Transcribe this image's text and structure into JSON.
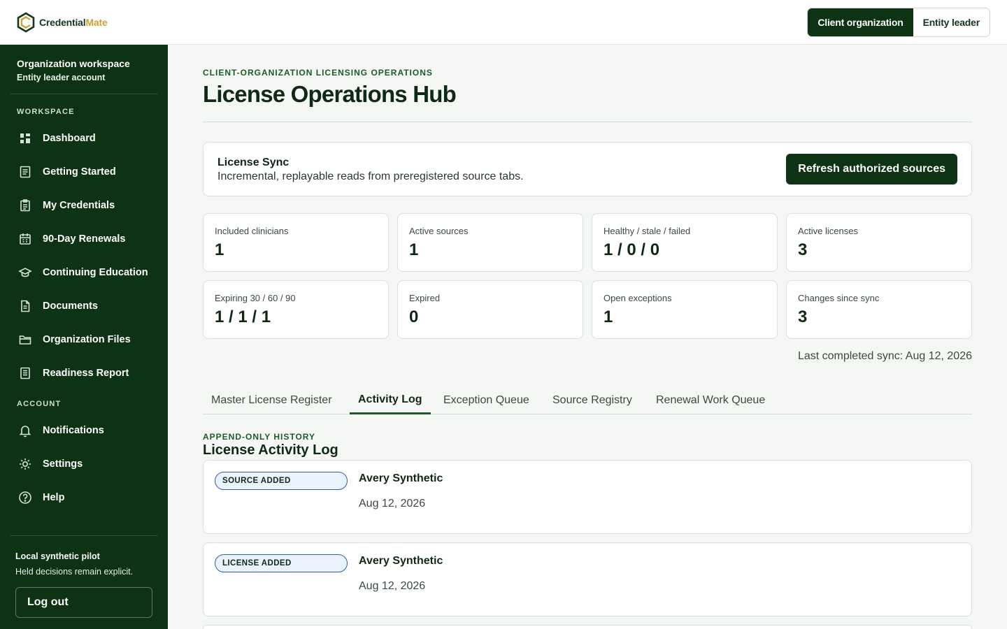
{
  "brand": {
    "name_primary": "Credential",
    "name_accent": "Mate"
  },
  "role_switch": {
    "options": [
      "Client organization",
      "Entity leader"
    ],
    "selected": "Client organization"
  },
  "sidebar": {
    "workspace_title": "Organization workspace",
    "workspace_subtitle": "Entity leader account",
    "workspace_section": "WORKSPACE",
    "workspace_items": [
      {
        "label": "Dashboard",
        "icon": "dashboard-icon"
      },
      {
        "label": "Getting Started",
        "icon": "checklist-icon"
      },
      {
        "label": "My Credentials",
        "icon": "clipboard-icon"
      },
      {
        "label": "90-Day Renewals",
        "icon": "calendar-icon"
      },
      {
        "label": "Continuing Education",
        "icon": "graduation-cap-icon"
      },
      {
        "label": "Documents",
        "icon": "document-icon"
      },
      {
        "label": "Organization Files",
        "icon": "folder-icon"
      },
      {
        "label": "Readiness Report",
        "icon": "report-icon"
      }
    ],
    "account_section": "ACCOUNT",
    "account_items": [
      {
        "label": "Notifications",
        "icon": "bell-icon"
      },
      {
        "label": "Settings",
        "icon": "gear-icon"
      },
      {
        "label": "Help",
        "icon": "help-icon"
      }
    ],
    "pilot_title": "Local synthetic pilot",
    "pilot_subtitle": "Held decisions remain explicit.",
    "logout_label": "Log out"
  },
  "header": {
    "eyebrow": "CLIENT-ORGANIZATION LICENSING OPERATIONS",
    "title": "License Operations Hub"
  },
  "sync": {
    "title": "License Sync",
    "subtitle": "Incremental, replayable reads from preregistered source tabs.",
    "button_label": "Refresh authorized sources",
    "last_completed": "Last completed sync: Aug 12, 2026"
  },
  "stats": [
    {
      "label": "Included clinicians",
      "value": "1"
    },
    {
      "label": "Active sources",
      "value": "1"
    },
    {
      "label": "Healthy / stale / failed",
      "value": "1 / 0 / 0"
    },
    {
      "label": "Active licenses",
      "value": "3"
    },
    {
      "label": "Expiring 30 / 60 / 90",
      "value": "1 / 1 / 1"
    },
    {
      "label": "Expired",
      "value": "0"
    },
    {
      "label": "Open exceptions",
      "value": "1"
    },
    {
      "label": "Changes since sync",
      "value": "3"
    }
  ],
  "tabs": {
    "items": [
      "Master License Register",
      "Activity Log",
      "Exception Queue",
      "Source Registry",
      "Renewal Work Queue"
    ],
    "active": "Activity Log"
  },
  "activity": {
    "eyebrow": "APPEND-ONLY HISTORY",
    "title": "License Activity Log",
    "entries": [
      {
        "badge": "SOURCE ADDED",
        "name": "Avery Synthetic",
        "date": "Aug 12, 2026"
      },
      {
        "badge": "LICENSE ADDED",
        "name": "Avery Synthetic",
        "date": "Aug 12, 2026"
      }
    ]
  },
  "colors": {
    "brand_dark_green": "#0e3314",
    "brand_gold": "#c9a23a",
    "badge_blue": "#2f5fa8"
  }
}
